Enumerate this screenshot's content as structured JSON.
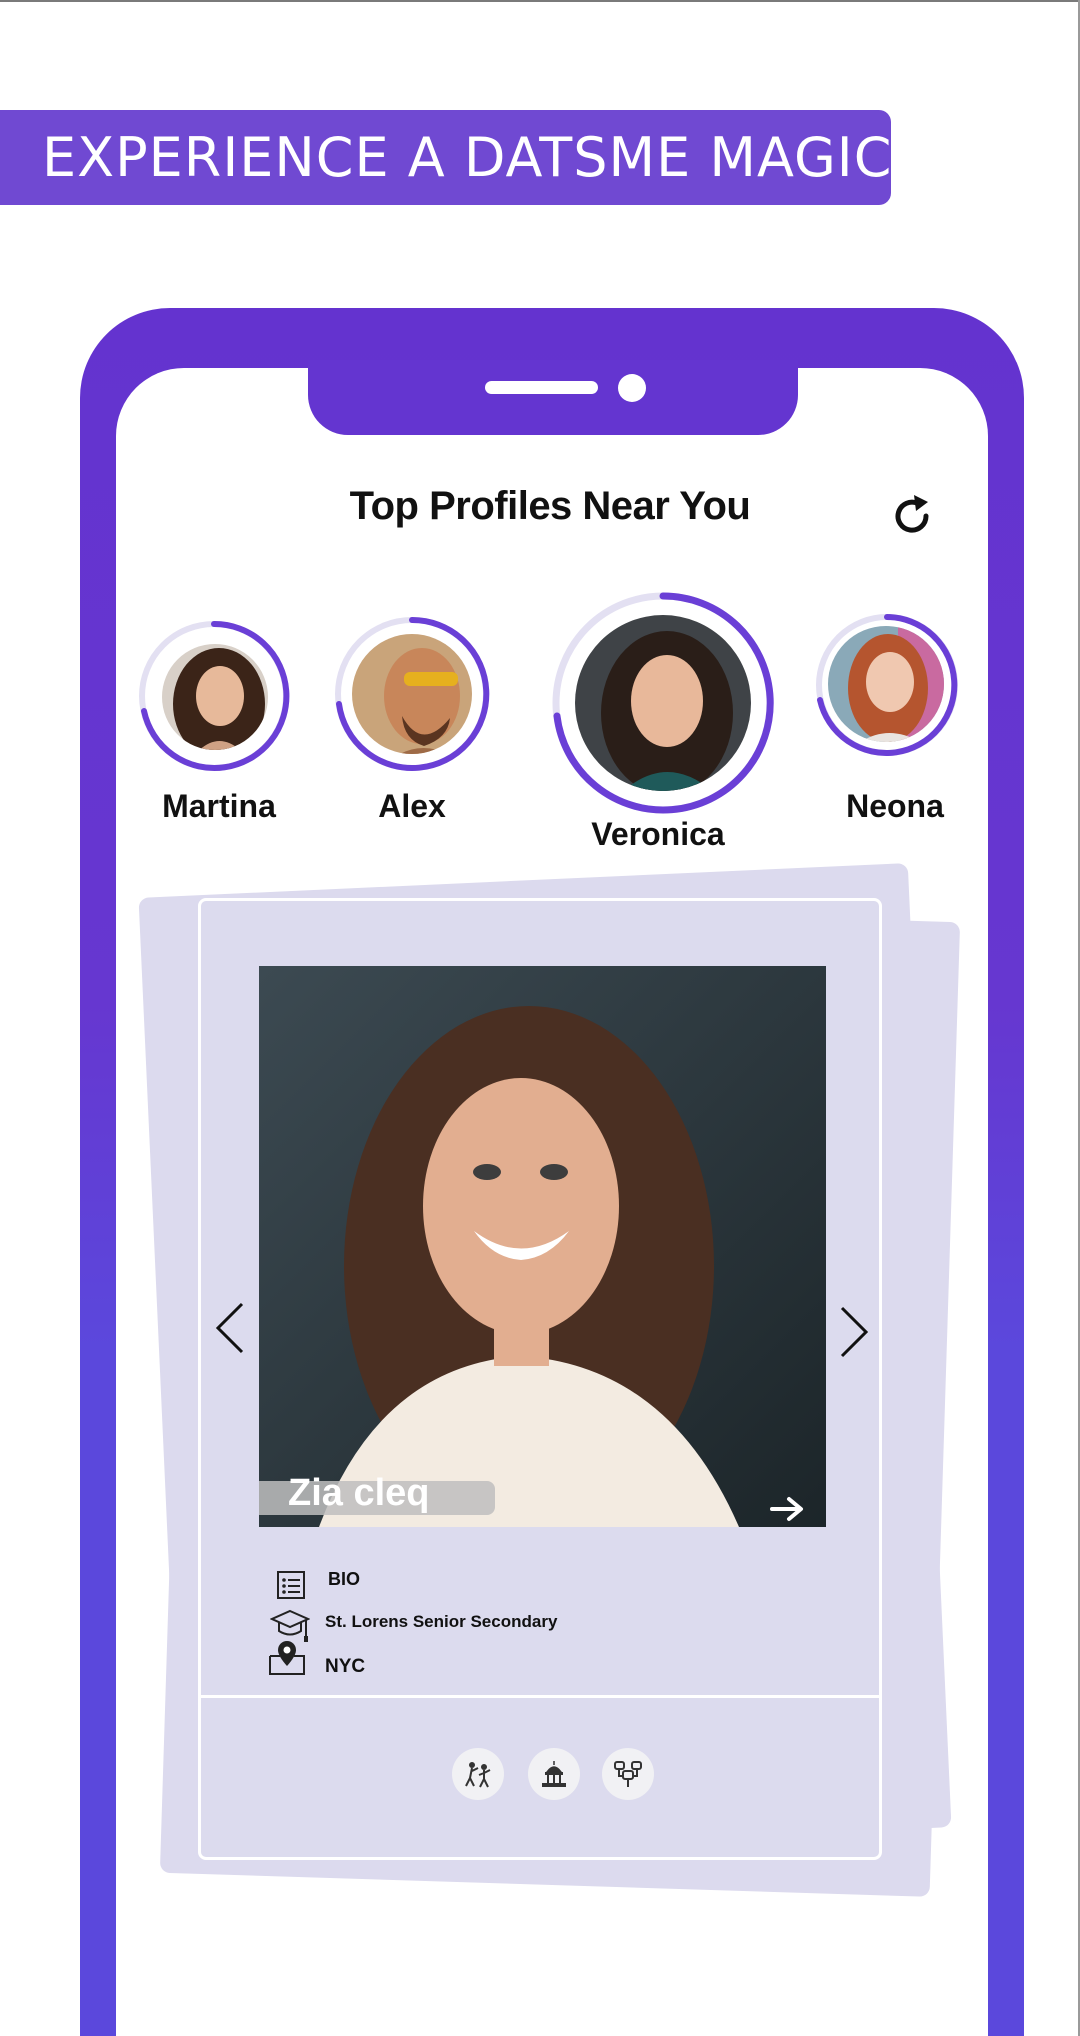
{
  "banner": {
    "text": "EXPERIENCE A DATSME MAGIC"
  },
  "screen": {
    "title": "Top Profiles Near You",
    "refresh_icon": "refresh-icon"
  },
  "stories": [
    {
      "name": "Martina",
      "selected": false
    },
    {
      "name": "Alex",
      "selected": false
    },
    {
      "name": "Veronica",
      "selected": true
    },
    {
      "name": "Neona",
      "selected": false
    }
  ],
  "card": {
    "name": "Zia cleq",
    "details": [
      {
        "icon": "list-icon",
        "text": "BIO"
      },
      {
        "icon": "graduation-cap-icon",
        "text": "St. Lorens Senior Secondary"
      },
      {
        "icon": "map-pin-icon",
        "text": "NYC"
      }
    ],
    "interests": [
      {
        "icon": "dance-icon"
      },
      {
        "icon": "monument-icon"
      },
      {
        "icon": "gaming-icon"
      }
    ]
  },
  "colors": {
    "primary": "#6435d0",
    "banner": "#7049d2",
    "card_bg": "#dcdbee",
    "ring": "#6a3fd6"
  }
}
